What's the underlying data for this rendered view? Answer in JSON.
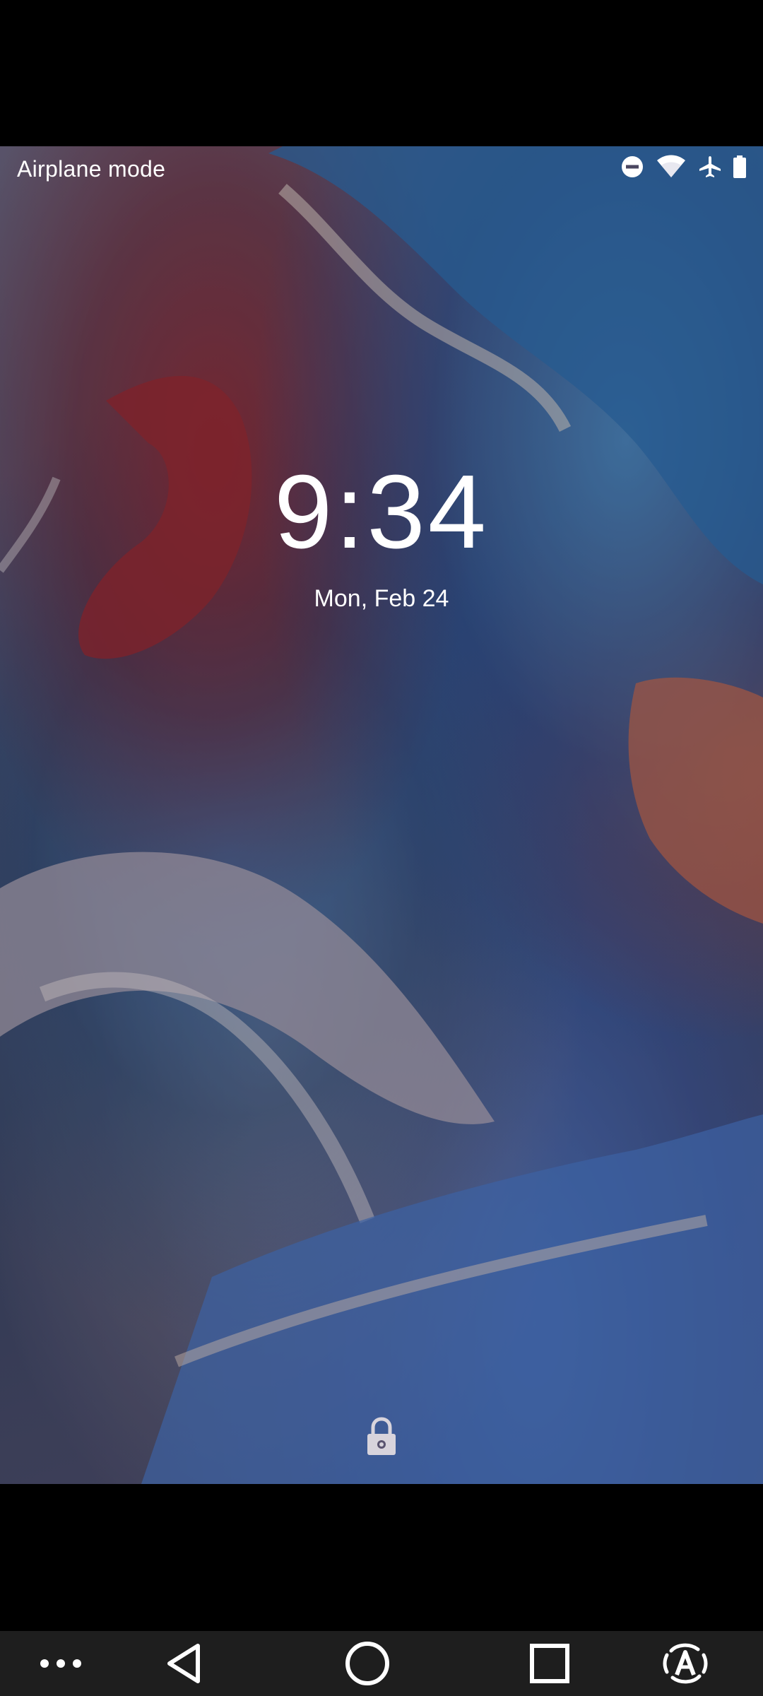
{
  "status_bar": {
    "mode_text": "Airplane mode",
    "icons": [
      "do-not-disturb-icon",
      "wifi-icon",
      "airplane-icon",
      "battery-icon"
    ]
  },
  "lockscreen": {
    "time": "9:34",
    "date": "Mon, Feb 24",
    "lock_icon": "lock-icon"
  },
  "nav_bar": {
    "buttons": [
      "more-icon",
      "back-icon",
      "home-icon",
      "recents-icon",
      "accessibility-icon"
    ]
  },
  "colors": {
    "status_text": "#ffffff",
    "nav_background": "#1e1e1e",
    "frame": "#000000"
  }
}
